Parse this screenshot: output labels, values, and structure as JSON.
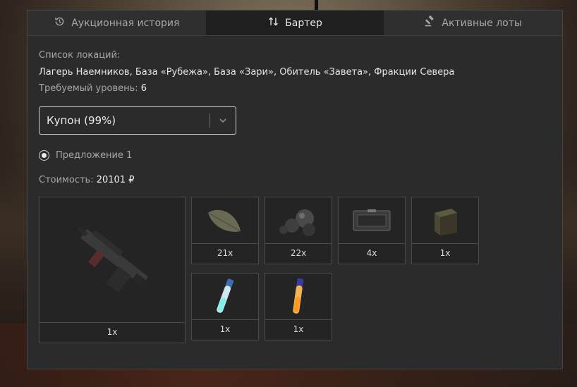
{
  "tabs": [
    {
      "label": "Аукционная история",
      "icon": "history-icon",
      "active": false
    },
    {
      "label": "Бартер",
      "icon": "swap-arrows-icon",
      "active": true
    },
    {
      "label": "Активные лоты",
      "icon": "gavel-icon",
      "active": false
    }
  ],
  "info": {
    "locations_label": "Список локаций:",
    "locations_value": "Лагерь Наемников, База «Рубежа», База «Зари», Обитель «Завета», Фракции Севера",
    "level_label": "Требуемый уровень:",
    "level_value": "6"
  },
  "select": {
    "value": "Купон (99%)"
  },
  "offer": {
    "label": "Предложение 1",
    "selected": true
  },
  "cost": {
    "label": "Стоимость:",
    "value": "20101 ₽"
  },
  "items": [
    {
      "name": "weapon-item",
      "icon": "rifle-icon",
      "count": "1x"
    },
    {
      "name": "leaf-item",
      "icon": "leaf-icon",
      "count": "21x"
    },
    {
      "name": "spheres-item",
      "icon": "spheres-icon",
      "count": "22x"
    },
    {
      "name": "case-item",
      "icon": "case-icon",
      "count": "4x"
    },
    {
      "name": "box-item",
      "icon": "box-icon",
      "count": "1x"
    },
    {
      "name": "vial-blue-item",
      "icon": "vial-blue-icon",
      "count": "1x"
    },
    {
      "name": "vial-orange-item",
      "icon": "vial-orange-icon",
      "count": "1x"
    }
  ]
}
